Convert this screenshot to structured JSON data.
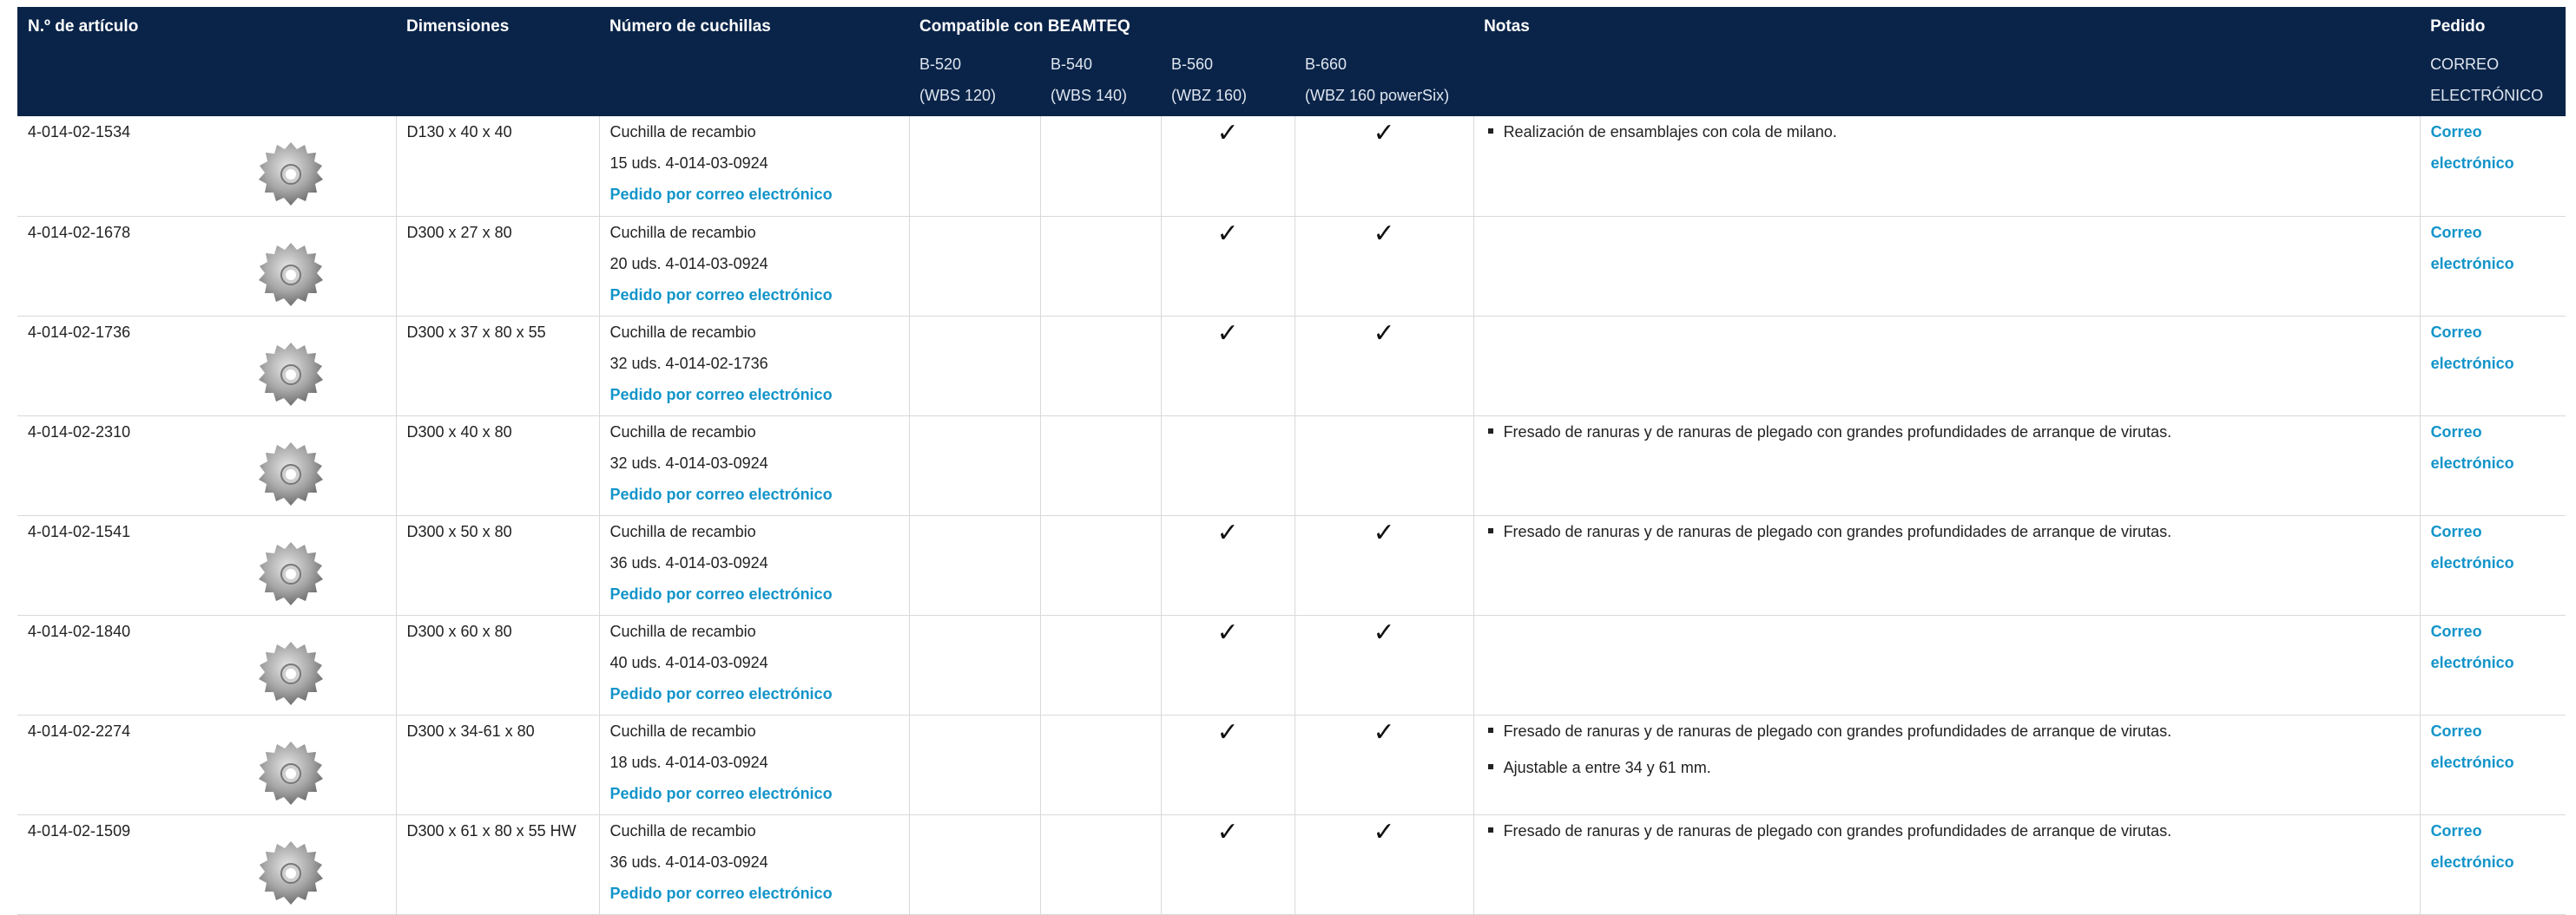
{
  "header": {
    "art_no": "N.º de artículo",
    "dimensions": "Dimensiones",
    "blades": "Número de cuchillas",
    "compatible": "Compatible con BEAMTEQ",
    "notes": "Notas",
    "order": "Pedido",
    "machines": [
      {
        "model": "B-520",
        "code": "(WBS 120)"
      },
      {
        "model": "B-540",
        "code": "(WBS 140)"
      },
      {
        "model": "B-560",
        "code": "(WBZ 160)"
      },
      {
        "model": "B-660",
        "code": "(WBZ 160 powerSix)"
      }
    ],
    "order_sub1": "CORREO",
    "order_sub2": "ELECTRÓNICO"
  },
  "rows": [
    {
      "art": "4-014-02-1534",
      "dim": "D130 x 40 x 40",
      "blade": "Cuchilla de recambio",
      "spare": "15 uds. 4-014-03-0924",
      "order_link": "Pedido por correo electrónico",
      "checks": [
        "",
        "",
        "✓",
        "✓"
      ],
      "notes": [
        "Realización de ensamblajes con cola de milano."
      ],
      "email1": "Correo",
      "email2": "electrónico",
      "icon": "cutter-blade-icon"
    },
    {
      "art": "4-014-02-1678",
      "dim": "D300 x 27 x 80",
      "blade": "Cuchilla de recambio",
      "spare": "20 uds. 4-014-03-0924",
      "order_link": "Pedido por correo electrónico",
      "checks": [
        "",
        "",
        "✓",
        "✓"
      ],
      "notes": [],
      "email1": "Correo",
      "email2": "electrónico",
      "icon": "cutter-blade-icon"
    },
    {
      "art": "4-014-02-1736",
      "dim": "D300 x 37 x 80 x 55",
      "blade": "Cuchilla de recambio",
      "spare": "32 uds. 4-014-02-1736",
      "order_link": "Pedido por correo electrónico",
      "checks": [
        "",
        "",
        "✓",
        "✓"
      ],
      "notes": [],
      "email1": "Correo",
      "email2": "electrónico",
      "icon": "cutter-blade-icon"
    },
    {
      "art": "4-014-02-2310",
      "dim": "D300 x 40 x 80",
      "blade": "Cuchilla de recambio",
      "spare": "32 uds. 4-014-03-0924",
      "order_link": "Pedido por correo electrónico",
      "checks": [
        "",
        "",
        "",
        ""
      ],
      "notes": [
        "Fresado de ranuras y de ranuras de plegado con grandes profundidades de arranque de virutas."
      ],
      "email1": "Correo",
      "email2": "electrónico",
      "icon": "cutter-blade-icon"
    },
    {
      "art": "4-014-02-1541",
      "dim": "D300 x 50 x 80",
      "blade": "Cuchilla de recambio",
      "spare": "36 uds. 4-014-03-0924",
      "order_link": "Pedido por correo electrónico",
      "checks": [
        "",
        "",
        "✓",
        "✓"
      ],
      "notes": [
        "Fresado de ranuras y de ranuras de plegado con grandes profundidades de arranque de virutas."
      ],
      "email1": "Correo",
      "email2": "electrónico",
      "icon": "cutter-blade-icon"
    },
    {
      "art": "4-014-02-1840",
      "dim": "D300 x 60 x 80",
      "blade": "Cuchilla de recambio",
      "spare": "40 uds. 4-014-03-0924",
      "order_link": "Pedido por correo electrónico",
      "checks": [
        "",
        "",
        "✓",
        "✓"
      ],
      "notes": [],
      "email1": "Correo",
      "email2": "electrónico",
      "icon": "cutter-blade-icon"
    },
    {
      "art": "4-014-02-2274",
      "dim": "D300 x 34-61 x 80",
      "blade": "Cuchilla de recambio",
      "spare": "18 uds. 4-014-03-0924",
      "order_link": "Pedido por correo electrónico",
      "checks": [
        "",
        "",
        "✓",
        "✓"
      ],
      "notes": [
        "Fresado de ranuras y de ranuras de plegado con grandes profundidades de arranque de virutas.",
        "Ajustable a entre 34 y 61 mm."
      ],
      "email1": "Correo",
      "email2": "electrónico",
      "icon": "cutter-blade-icon"
    },
    {
      "art": "4-014-02-1509",
      "dim": "D300 x 61 x 80 x 55 HW",
      "blade": "Cuchilla de recambio",
      "spare": "36 uds. 4-014-03-0924",
      "order_link": "Pedido por correo electrónico",
      "checks": [
        "",
        "",
        "✓",
        "✓"
      ],
      "notes": [
        "Fresado de ranuras y de ranuras de plegado con grandes profundidades de arranque de virutas."
      ],
      "email1": "Correo",
      "email2": "electrónico",
      "icon": "cutter-blade-icon"
    }
  ],
  "colors": {
    "header_bg": "#0a2449",
    "link": "#1294c9",
    "border": "#d9d9d9"
  }
}
